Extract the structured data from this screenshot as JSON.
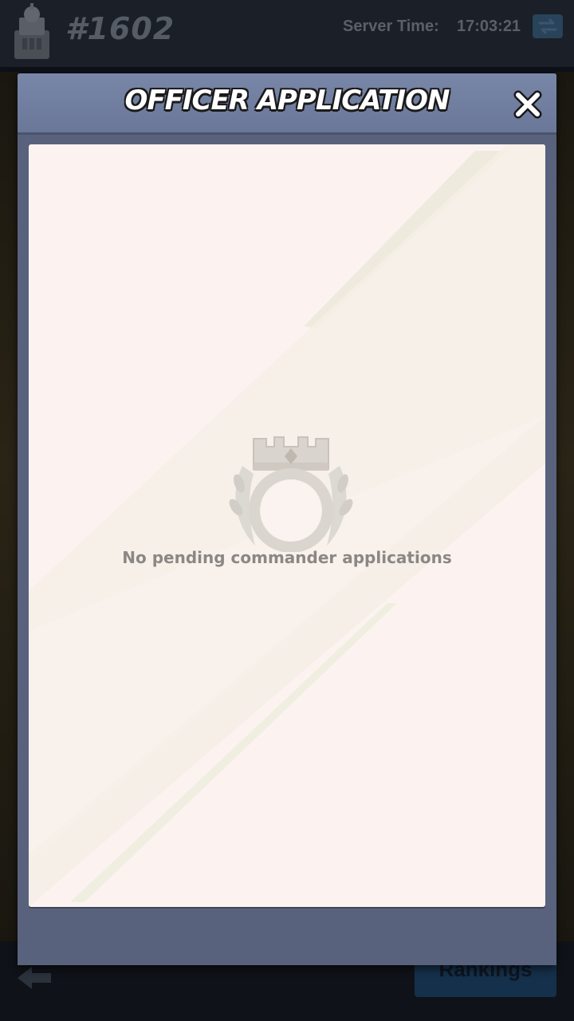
{
  "topbar": {
    "server_number": "#1602",
    "server_time_label": "Server Time:",
    "server_time_value": "17:03:21"
  },
  "modal": {
    "title": "OFFICER APPLICATION",
    "empty_message": "No pending commander applications"
  },
  "bottombar": {
    "rankings_label": "Rankings"
  },
  "colors": {
    "modal_header": "#7886a8",
    "modal_body": "#58627d",
    "content_panel": "#fcf3f1",
    "empty_text": "#8a8784"
  },
  "icons": {
    "close": "close-icon",
    "swap": "swap-arrows-icon",
    "back": "back-arrow-icon",
    "emblem": "crown-ring-laurel-icon",
    "server": "castle-tower-icon"
  }
}
